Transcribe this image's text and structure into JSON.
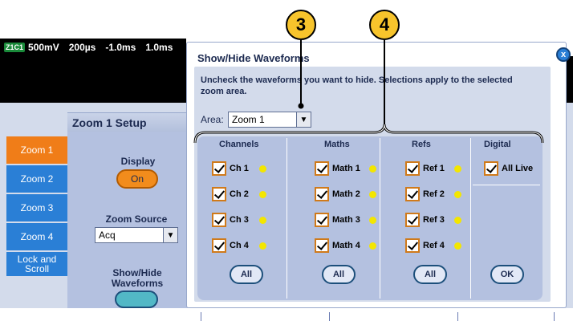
{
  "status_bar": {
    "tag": "Z1C1",
    "volts": "500mV",
    "time_div": "200µs",
    "delay": "-1.0ms",
    "pos": "1.0ms"
  },
  "zoom_tabs": [
    {
      "label": "Zoom 1"
    },
    {
      "label": "Zoom 2"
    },
    {
      "label": "Zoom 3"
    },
    {
      "label": "Zoom 4"
    },
    {
      "label": "Lock and Scroll"
    }
  ],
  "setup": {
    "title": "Zoom 1 Setup",
    "display_label": "Display",
    "display_value": "On",
    "source_label": "Zoom Source",
    "source_value": "Acq",
    "showhide_label": "Show/Hide Waveforms"
  },
  "dialog": {
    "title": "Show/Hide Waveforms",
    "instruction": "Uncheck the waveforms you want to hide. Selections apply to the selected zoom area.",
    "area_label": "Area:",
    "area_value": "Zoom 1",
    "close_label": "x",
    "columns": {
      "channels": {
        "header": "Channels",
        "items": [
          "Ch 1",
          "Ch 2",
          "Ch 3",
          "Ch 4"
        ],
        "button": "All"
      },
      "maths": {
        "header": "Maths",
        "items": [
          "Math 1",
          "Math 2",
          "Math 3",
          "Math 4"
        ],
        "button": "All"
      },
      "refs": {
        "header": "Refs",
        "items": [
          "Ref 1",
          "Ref 2",
          "Ref 3",
          "Ref 4"
        ],
        "button": "All"
      },
      "digital": {
        "header": "Digital",
        "items": [
          "All Live"
        ],
        "button": "OK"
      }
    }
  },
  "callouts": {
    "c3": "3",
    "c4": "4"
  },
  "colors": {
    "active_tab": "#f07d18",
    "tab": "#2a7fd6",
    "indicator": "#f3e600",
    "callout": "#f7c42c"
  }
}
